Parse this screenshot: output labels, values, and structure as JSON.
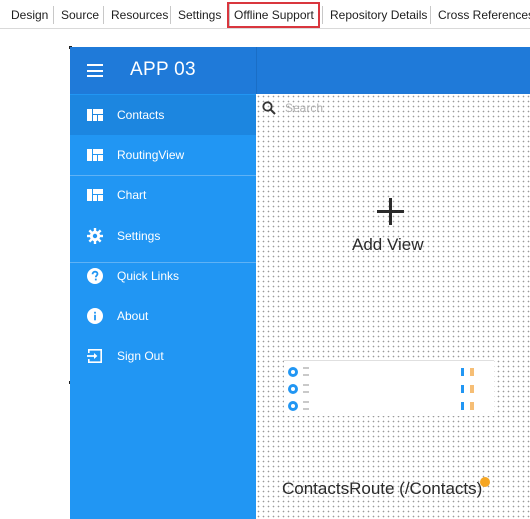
{
  "tabs": [
    {
      "label": "Design"
    },
    {
      "label": "Source"
    },
    {
      "label": "Resources"
    },
    {
      "label": "Settings"
    },
    {
      "label": "Offline Support",
      "active": true
    },
    {
      "label": "Repository Details"
    },
    {
      "label": "Cross References"
    }
  ],
  "app": {
    "title": "APP 03",
    "header_color": "#1f7ad9",
    "sidebar_color": "#2196f3"
  },
  "sidebar": {
    "items": [
      {
        "label": "Contacts",
        "icon": "dashboard-icon",
        "selected": true
      },
      {
        "label": "RoutingView",
        "icon": "dashboard-icon"
      },
      {
        "label": "Chart",
        "icon": "dashboard-icon"
      },
      {
        "label": "Settings",
        "icon": "gear-icon"
      },
      {
        "label": "Quick Links",
        "icon": "help-icon"
      },
      {
        "label": "About",
        "icon": "info-icon"
      },
      {
        "label": "Sign Out",
        "icon": "sign-out-icon"
      }
    ]
  },
  "content": {
    "search_placeholder": "Search",
    "add_view_label": "Add View",
    "route_label": "ContactsRoute (/Contacts)"
  },
  "accent": {
    "active_tab_outline": "#d9363e",
    "route_badge": "#f5a623"
  }
}
